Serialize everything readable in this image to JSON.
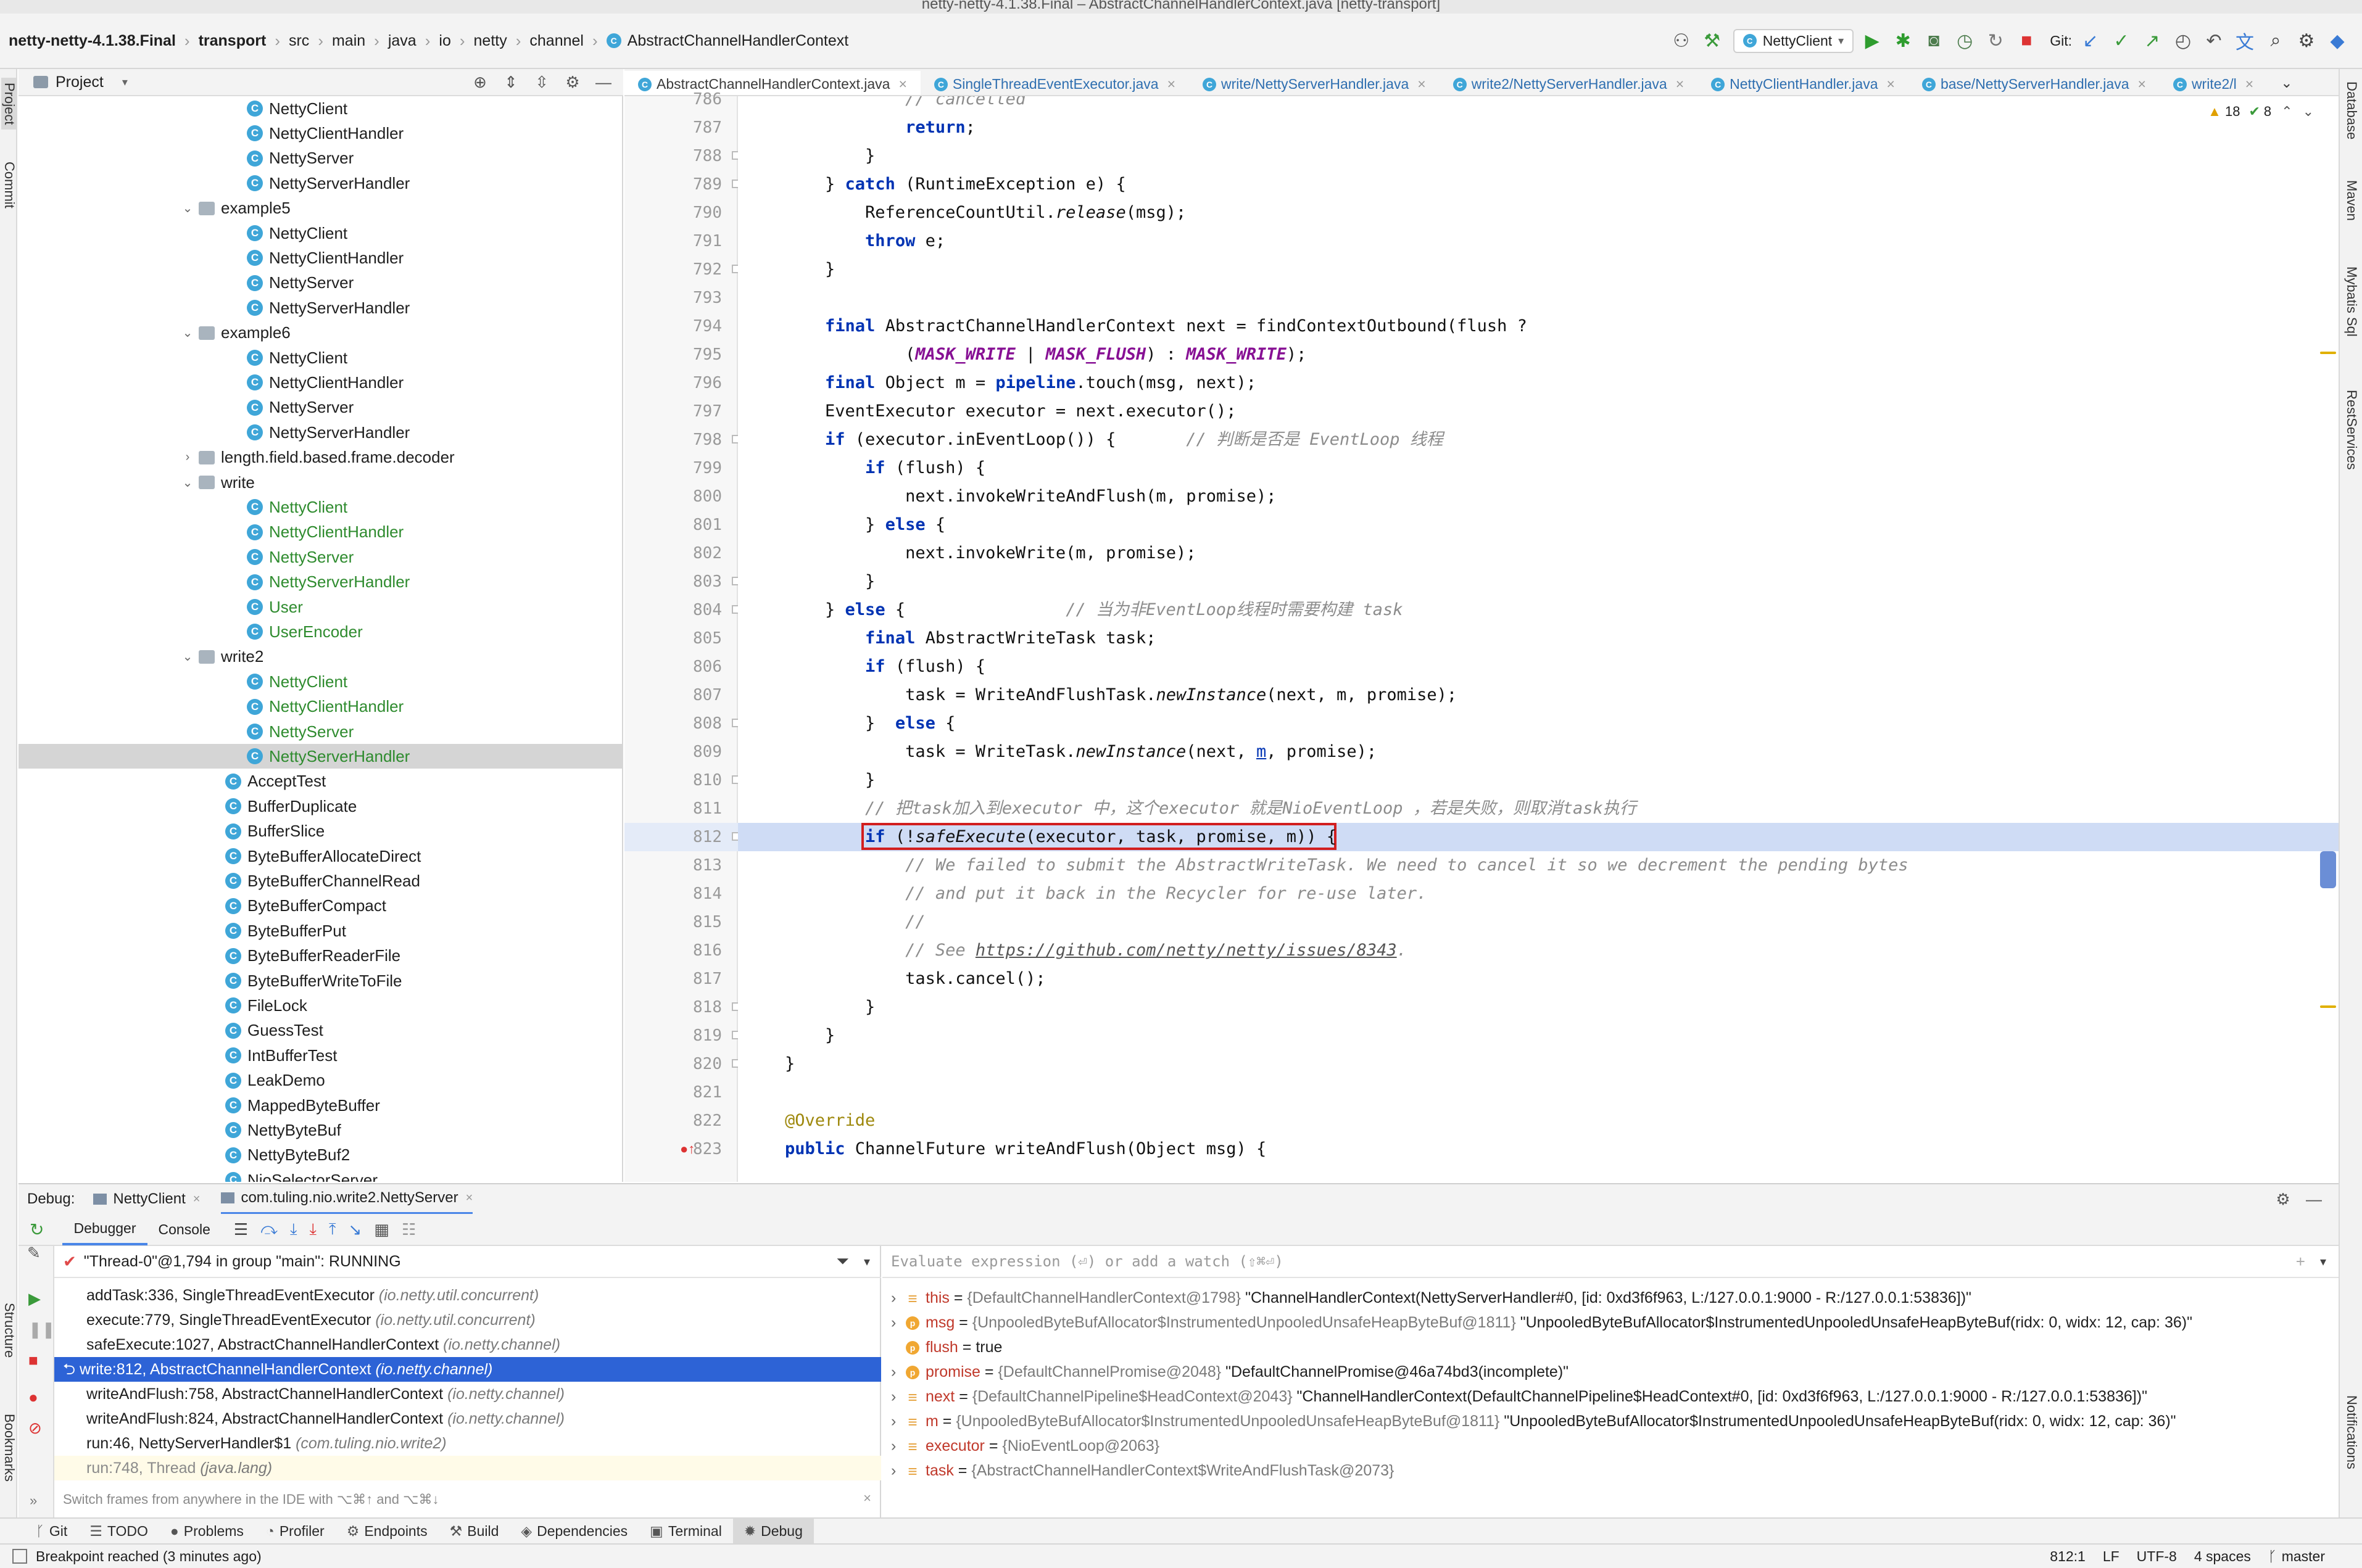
{
  "window": {
    "title": "netty-netty-4.1.38.Final – AbstractChannelHandlerContext.java [netty-transport]"
  },
  "breadcrumb": [
    "netty-netty-4.1.38.Final",
    "transport",
    "src",
    "main",
    "java",
    "io",
    "netty",
    "channel",
    "AbstractChannelHandlerContext"
  ],
  "toolbar": {
    "run_config": "NettyClient",
    "git_label": "Git:"
  },
  "project": {
    "label": "Project",
    "tree": [
      {
        "label": "NettyClient",
        "kind": "class",
        "depth": 3,
        "green": false
      },
      {
        "label": "NettyClientHandler",
        "kind": "class",
        "depth": 3,
        "green": false
      },
      {
        "label": "NettyServer",
        "kind": "class",
        "depth": 3,
        "green": false
      },
      {
        "label": "NettyServerHandler",
        "kind": "class",
        "depth": 3,
        "green": false
      },
      {
        "label": "example5",
        "kind": "folder",
        "depth": 2,
        "arrow": "v"
      },
      {
        "label": "NettyClient",
        "kind": "class",
        "depth": 3,
        "green": false
      },
      {
        "label": "NettyClientHandler",
        "kind": "class",
        "depth": 3,
        "green": false
      },
      {
        "label": "NettyServer",
        "kind": "class",
        "depth": 3,
        "green": false
      },
      {
        "label": "NettyServerHandler",
        "kind": "class",
        "depth": 3,
        "green": false
      },
      {
        "label": "example6",
        "kind": "folder",
        "depth": 2,
        "arrow": "v"
      },
      {
        "label": "NettyClient",
        "kind": "class",
        "depth": 3,
        "green": false
      },
      {
        "label": "NettyClientHandler",
        "kind": "class",
        "depth": 3,
        "green": false
      },
      {
        "label": "NettyServer",
        "kind": "class",
        "depth": 3,
        "green": false
      },
      {
        "label": "NettyServerHandler",
        "kind": "class",
        "depth": 3,
        "green": false
      },
      {
        "label": "length.field.based.frame.decoder",
        "kind": "folder",
        "depth": 2,
        "arrow": ">"
      },
      {
        "label": "write",
        "kind": "folder",
        "depth": 2,
        "arrow": "v"
      },
      {
        "label": "NettyClient",
        "kind": "class",
        "depth": 3,
        "green": true
      },
      {
        "label": "NettyClientHandler",
        "kind": "class",
        "depth": 3,
        "green": true
      },
      {
        "label": "NettyServer",
        "kind": "class",
        "depth": 3,
        "green": true
      },
      {
        "label": "NettyServerHandler",
        "kind": "class",
        "depth": 3,
        "green": true
      },
      {
        "label": "User",
        "kind": "class",
        "depth": 3,
        "green": true
      },
      {
        "label": "UserEncoder",
        "kind": "class",
        "depth": 3,
        "green": true
      },
      {
        "label": "write2",
        "kind": "folder",
        "depth": 2,
        "arrow": "v"
      },
      {
        "label": "NettyClient",
        "kind": "class",
        "depth": 3,
        "green": true
      },
      {
        "label": "NettyClientHandler",
        "kind": "class",
        "depth": 3,
        "green": true
      },
      {
        "label": "NettyServer",
        "kind": "class",
        "depth": 3,
        "green": true
      },
      {
        "label": "NettyServerHandler",
        "kind": "class",
        "depth": 3,
        "green": true,
        "selected": true
      },
      {
        "label": "AcceptTest",
        "kind": "class",
        "depth": 2,
        "green": false
      },
      {
        "label": "BufferDuplicate",
        "kind": "class",
        "depth": 2,
        "green": false
      },
      {
        "label": "BufferSlice",
        "kind": "class",
        "depth": 2,
        "green": false
      },
      {
        "label": "ByteBufferAllocateDirect",
        "kind": "class",
        "depth": 2,
        "green": false
      },
      {
        "label": "ByteBufferChannelRead",
        "kind": "class",
        "depth": 2,
        "green": false
      },
      {
        "label": "ByteBufferCompact",
        "kind": "class",
        "depth": 2,
        "green": false
      },
      {
        "label": "ByteBufferPut",
        "kind": "class",
        "depth": 2,
        "green": false
      },
      {
        "label": "ByteBufferReaderFile",
        "kind": "class",
        "depth": 2,
        "green": false
      },
      {
        "label": "ByteBufferWriteToFile",
        "kind": "class",
        "depth": 2,
        "green": false
      },
      {
        "label": "FileLock",
        "kind": "class",
        "depth": 2,
        "green": false
      },
      {
        "label": "GuessTest",
        "kind": "class",
        "depth": 2,
        "green": false
      },
      {
        "label": "IntBufferTest",
        "kind": "class",
        "depth": 2,
        "green": false
      },
      {
        "label": "LeakDemo",
        "kind": "class",
        "depth": 2,
        "green": false
      },
      {
        "label": "MappedByteBuffer",
        "kind": "class",
        "depth": 2,
        "green": false
      },
      {
        "label": "NettyByteBuf",
        "kind": "class",
        "depth": 2,
        "green": false
      },
      {
        "label": "NettyByteBuf2",
        "kind": "class",
        "depth": 2,
        "green": false
      },
      {
        "label": "NioSelectorServer",
        "kind": "class",
        "depth": 2,
        "green": false
      }
    ]
  },
  "editor": {
    "tabs": [
      {
        "label": "AbstractChannelHandlerContext.java",
        "active": true
      },
      {
        "label": "SingleThreadEventExecutor.java",
        "active": false
      },
      {
        "label": "write/NettyServerHandler.java",
        "active": false
      },
      {
        "label": "write2/NettyServerHandler.java",
        "active": false
      },
      {
        "label": "NettyClientHandler.java",
        "active": false
      },
      {
        "label": "base/NettyServerHandler.java",
        "active": false
      },
      {
        "label": "write2/l",
        "active": false
      }
    ],
    "warnings": "18",
    "checks": "8",
    "current_line": 812,
    "lines": [
      {
        "n": 786,
        "html": "            <span class='cm'>// cancelled</span>"
      },
      {
        "n": 787,
        "html": "            <span class='kw'>return</span>;"
      },
      {
        "n": 788,
        "html": "        }"
      },
      {
        "n": 789,
        "html": "    } <span class='kw'>catch</span> (RuntimeException e) {"
      },
      {
        "n": 790,
        "html": "        ReferenceCountUtil.<span class='it'>release</span>(msg);"
      },
      {
        "n": 791,
        "html": "        <span class='kw'>throw</span> e;"
      },
      {
        "n": 792,
        "html": "    }"
      },
      {
        "n": 793,
        "html": ""
      },
      {
        "n": 794,
        "html": "    <span class='kw'>final</span> AbstractChannelHandlerContext next = findContextOutbound(flush ?"
      },
      {
        "n": 795,
        "html": "            (<span class='st'>MASK_WRITE</span> | <span class='st'>MASK_FLUSH</span>) : <span class='st'>MASK_WRITE</span>);"
      },
      {
        "n": 796,
        "html": "    <span class='kw'>final</span> Object m = <span class='kw'>pipeline</span>.touch(msg, next);"
      },
      {
        "n": 797,
        "html": "    EventExecutor executor = next.executor();"
      },
      {
        "n": 798,
        "html": "    <span class='kw'>if</span> (executor.inEventLoop()) {       <span class='cm'>// 判断是否是 EventLoop 线程</span>"
      },
      {
        "n": 799,
        "html": "        <span class='kw'>if</span> (flush) {"
      },
      {
        "n": 800,
        "html": "            next.invokeWriteAndFlush(m, promise);"
      },
      {
        "n": 801,
        "html": "        } <span class='kw'>else</span> {"
      },
      {
        "n": 802,
        "html": "            next.invokeWrite(m, promise);"
      },
      {
        "n": 803,
        "html": "        }"
      },
      {
        "n": 804,
        "html": "    } <span class='kw'>else</span> {                <span class='cm'>// 当为非EventLoop线程时需要构建 task</span>"
      },
      {
        "n": 805,
        "html": "        <span class='kw'>final</span> AbstractWriteTask task;"
      },
      {
        "n": 806,
        "html": "        <span class='kw'>if</span> (flush) {"
      },
      {
        "n": 807,
        "html": "            task = WriteAndFlushTask.<span class='it'>newInstance</span>(next, m, promise);"
      },
      {
        "n": 808,
        "html": "        }  <span class='kw'>else</span> {"
      },
      {
        "n": 809,
        "html": "            task = WriteTask.<span class='it'>newInstance</span>(next, <u style='color:#0033b3'>m</u>, promise);"
      },
      {
        "n": 810,
        "html": "        }"
      },
      {
        "n": 811,
        "html": "        <span class='cm'>// 把task加入到executor 中，这个executor 就是NioEventLoop ，若是失败，则取消task执行</span>"
      },
      {
        "n": 812,
        "html": "        <span class='kw'>if</span> (!<span class='it'>safeExecute</span>(executor, task, promise, m)) {"
      },
      {
        "n": 813,
        "html": "            <span class='cm'>// We failed to submit the AbstractWriteTask. We need to cancel it so we decrement the pending bytes</span>"
      },
      {
        "n": 814,
        "html": "            <span class='cm'>// and put it back in the Recycler for re-use later.</span>"
      },
      {
        "n": 815,
        "html": "            <span class='cm'>//</span>"
      },
      {
        "n": 816,
        "html": "            <span class='cm'>// See <span class='lnk'>https://github.com/netty/netty/issues/8343</span>.</span>"
      },
      {
        "n": 817,
        "html": "            task.cancel();"
      },
      {
        "n": 818,
        "html": "        }"
      },
      {
        "n": 819,
        "html": "    }"
      },
      {
        "n": 820,
        "html": "}"
      },
      {
        "n": 821,
        "html": ""
      },
      {
        "n": 822,
        "html": "<span class='an'>@Override</span>"
      },
      {
        "n": 823,
        "html": "<span class='kw'>public</span> ChannelFuture writeAndFlush(Object msg) {"
      }
    ]
  },
  "debug": {
    "label": "Debug:",
    "sessions": [
      "NettyClient",
      "com.tuling.nio.write2.NettyServer"
    ],
    "tabs": [
      "Debugger",
      "Console"
    ],
    "thread": "\"Thread-0\"@1,794 in group \"main\": RUNNING",
    "frames": [
      {
        "method": "addTask:336, SingleThreadEventExecutor",
        "pkg": "(io.netty.util.concurrent)"
      },
      {
        "method": "execute:779, SingleThreadEventExecutor",
        "pkg": "(io.netty.util.concurrent)"
      },
      {
        "method": "safeExecute:1027, AbstractChannelHandlerContext",
        "pkg": "(io.netty.channel)"
      },
      {
        "method": "write:812, AbstractChannelHandlerContext",
        "pkg": "(io.netty.channel)",
        "selected": true
      },
      {
        "method": "writeAndFlush:758, AbstractChannelHandlerContext",
        "pkg": "(io.netty.channel)"
      },
      {
        "method": "writeAndFlush:824, AbstractChannelHandlerContext",
        "pkg": "(io.netty.channel)"
      },
      {
        "method": "run:46, NettyServerHandler$1",
        "pkg": "(com.tuling.nio.write2)"
      },
      {
        "method": "run:748, Thread",
        "pkg": "(java.lang)",
        "dim": true
      }
    ],
    "frames_hint": "Switch frames from anywhere in the IDE with ⌥⌘↑ and ⌥⌘↓",
    "eval_placeholder": "Evaluate expression (⏎) or add a watch (⇧⌘⏎)",
    "variables": [
      {
        "icon": "lines",
        "name": "this",
        "type": "{DefaultChannelHandlerContext@1798}",
        "value": "\"ChannelHandlerContext(NettyServerHandler#0, [id: 0xd3f6f963, L:/127.0.0.1:9000 - R:/127.0.0.1:53836])\"",
        "expand": true
      },
      {
        "icon": "p",
        "name": "msg",
        "type": "{UnpooledByteBufAllocator$InstrumentedUnpooledUnsafeHeapByteBuf@1811}",
        "value": "\"UnpooledByteBufAllocator$InstrumentedUnpooledUnsafeHeapByteBuf(ridx: 0, widx: 12, cap: 36)\"",
        "expand": true
      },
      {
        "icon": "p",
        "name": "flush",
        "type": "",
        "value": "true",
        "expand": false
      },
      {
        "icon": "p",
        "name": "promise",
        "type": "{DefaultChannelPromise@2048}",
        "value": "\"DefaultChannelPromise@46a74bd3(incomplete)\"",
        "expand": true
      },
      {
        "icon": "lines",
        "name": "next",
        "type": "{DefaultChannelPipeline$HeadContext@2043}",
        "value": "\"ChannelHandlerContext(DefaultChannelPipeline$HeadContext#0, [id: 0xd3f6f963, L:/127.0.0.1:9000 - R:/127.0.0.1:53836])\"",
        "expand": true
      },
      {
        "icon": "lines",
        "name": "m",
        "type": "{UnpooledByteBufAllocator$InstrumentedUnpooledUnsafeHeapByteBuf@1811}",
        "value": "\"UnpooledByteBufAllocator$InstrumentedUnpooledUnsafeHeapByteBuf(ridx: 0, widx: 12, cap: 36)\"",
        "expand": true
      },
      {
        "icon": "lines",
        "name": "executor",
        "type": "{NioEventLoop@2063}",
        "value": "",
        "expand": true
      },
      {
        "icon": "lines",
        "name": "task",
        "type": "{AbstractChannelHandlerContext$WriteAndFlushTask@2073}",
        "value": "",
        "expand": true
      }
    ]
  },
  "toolwindows": [
    {
      "label": "Git",
      "icon": "ᚴ"
    },
    {
      "label": "TODO",
      "icon": "☰"
    },
    {
      "label": "Problems",
      "icon": "●"
    },
    {
      "label": "Profiler",
      "icon": "◔"
    },
    {
      "label": "Endpoints",
      "icon": "⚙"
    },
    {
      "label": "Build",
      "icon": "⚒"
    },
    {
      "label": "Dependencies",
      "icon": "◈"
    },
    {
      "label": "Terminal",
      "icon": "▣"
    },
    {
      "label": "Debug",
      "icon": "✹",
      "active": true
    }
  ],
  "side_tabs": {
    "left_top": [
      "Project",
      "Commit"
    ],
    "left_bottom": [
      "Structure",
      "Bookmarks"
    ],
    "right": [
      "Database",
      "Maven",
      "Mybatis Sql",
      "RestServices",
      "Notifications"
    ]
  },
  "status": {
    "message": "Breakpoint reached (3 minutes ago)",
    "position": "812:1",
    "line_sep": "LF",
    "encoding": "UTF-8",
    "indent": "4 spaces",
    "branch": "master"
  }
}
